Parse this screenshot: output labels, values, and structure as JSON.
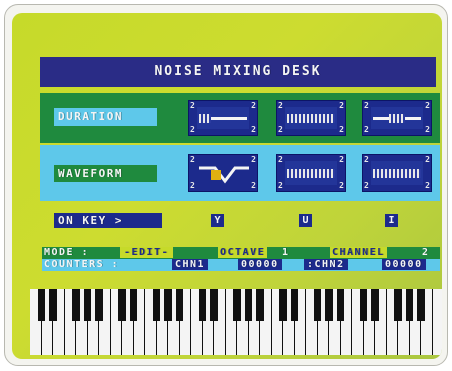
{
  "header": {
    "title": "NOISE MIXING DESK"
  },
  "duration": {
    "label": "DURATION",
    "slot_digit": "2"
  },
  "waveform": {
    "label": "WAVEFORM",
    "slot_digit": "2"
  },
  "on_key": {
    "label": "ON KEY >",
    "keys": [
      "Y",
      "U",
      "I"
    ]
  },
  "status": {
    "mode_label": "MODE :",
    "mode_value": "-EDIT-",
    "octave_label": "OCTAVE",
    "octave_value": "1",
    "channel_label": "CHANNEL",
    "channel_value": "2",
    "counters_label": "COUNTERS :",
    "chn1_label": "CHN1",
    "chn1_value": "00000",
    "chn2_label": ":CHN2",
    "chn2_value": "00000"
  },
  "colors": {
    "screen_green": "#c6da2a",
    "title_bar": "#2a2c86",
    "duration_band": "#1f8a3e",
    "waveform_band": "#5ec8ea",
    "slot_blue": "#1c2a8c",
    "selected_yellow": "#e0b010",
    "text_white": "#f4f4f4"
  },
  "keyboard": {
    "white_keys": 36
  }
}
